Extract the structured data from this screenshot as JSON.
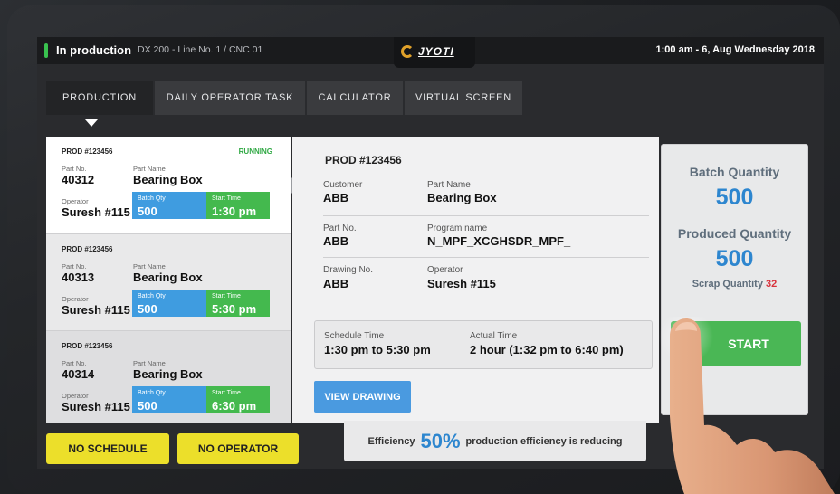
{
  "status_bar": {
    "state": "In production",
    "line_info": "DX 200 - Line No. 1 / CNC 01",
    "brand": "JYOTI",
    "datetime": "1:00 am - 6, Aug Wednesday 2018"
  },
  "tabs": [
    {
      "label": "PRODUCTION",
      "active": true
    },
    {
      "label": "DAILY OPERATOR TASK",
      "active": false
    },
    {
      "label": "CALCULATOR",
      "active": false
    },
    {
      "label": "VIRTUAL SCREEN",
      "active": false
    }
  ],
  "production_list": [
    {
      "prod": "PROD #123456",
      "status": "RUNNING",
      "part_no_label": "Part No.",
      "part_no": "40312",
      "part_name_label": "Part Name",
      "part_name": "Bearing Box",
      "operator_label": "Operator",
      "operator": "Suresh #115",
      "batch_label": "Batch Qty",
      "batch": "500",
      "start_label": "Start Time",
      "start": "1:30 pm"
    },
    {
      "prod": "PROD #123456",
      "status": "",
      "part_no_label": "Part No.",
      "part_no": "40313",
      "part_name_label": "Part Name",
      "part_name": "Bearing Box",
      "operator_label": "Operator",
      "operator": "Suresh #115",
      "batch_label": "Batch Qty",
      "batch": "500",
      "start_label": "Start Time",
      "start": "5:30 pm"
    },
    {
      "prod": "PROD #123456",
      "status": "",
      "part_no_label": "Part No.",
      "part_no": "40314",
      "part_name_label": "Part Name",
      "part_name": "Bearing Box",
      "operator_label": "Operator",
      "operator": "Suresh #115",
      "batch_label": "Batch Qty",
      "batch": "500",
      "start_label": "Start Time",
      "start": "6:30 pm"
    }
  ],
  "detail": {
    "title": "PROD #123456",
    "customer_label": "Customer",
    "customer": "ABB",
    "part_name_label": "Part Name",
    "part_name": "Bearing Box",
    "part_no_label": "Part No.",
    "part_no": "ABB",
    "program_label": "Program name",
    "program": "N_MPF_XCGHSDR_MPF_",
    "drawing_label": "Drawing No.",
    "drawing": "ABB",
    "operator_label": "Operator",
    "operator": "Suresh #115",
    "schedule_label": "Schedule Time",
    "schedule": "1:30 pm to 5:30 pm",
    "actual_label": "Actual Time",
    "actual": "2 hour (1:32 pm to 6:40 pm)",
    "view_drawing": "VIEW DRAWING"
  },
  "summary": {
    "batch_label": "Batch Quantity",
    "batch": "500",
    "produced_label": "Produced Quantity",
    "produced": "500",
    "scrap_label": "Scrap Quantity",
    "scrap": "32",
    "start": "START"
  },
  "bottom": {
    "no_schedule": "NO SCHEDULE",
    "no_operator": "NO OPERATOR",
    "efficiency_label": "Efficiency",
    "efficiency_pct": "50%",
    "efficiency_note": "production efficiency is reducing"
  },
  "colors": {
    "running": "#2fa843",
    "accent_blue": "#2d86cf",
    "start_green": "#4ab755",
    "warning_yellow": "#ecdf2a",
    "scrap_red": "#d8323c"
  }
}
